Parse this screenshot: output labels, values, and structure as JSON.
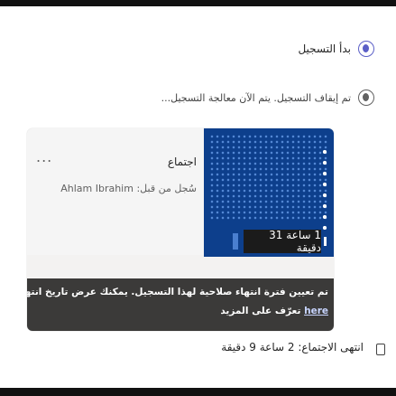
{
  "rows": [
    {
      "text": "بدأ التسجيل",
      "icon": "record-icon"
    },
    {
      "text": "تم إيقاف التسجيل. يتم الآن معالجة التسجيل...",
      "icon": "record-icon"
    }
  ],
  "card": {
    "more_label": "...",
    "title": "اجتماع",
    "recorded_by": "سُجل من قبل: Ahlam Ibrahim",
    "duration": "1 ساعة 31 دقيقة",
    "banner_message": "تم تعيين فترة انتهاء صلاحية لهذا التسجيل. يمكنك عرض تاريخ انتهاء الصلاحية أو تغييره",
    "banner_link": "here",
    "banner_more": "تعرّف على المزيد"
  },
  "footer": {
    "text": "انتهى الاجتماع: 2 ساعة 9 دقيقة",
    "icon": "meeting-end-icon"
  },
  "colors": {
    "accent": "#5b5fc7",
    "banner": "#3b3a39",
    "thumbnail": "#0d3f8c"
  }
}
